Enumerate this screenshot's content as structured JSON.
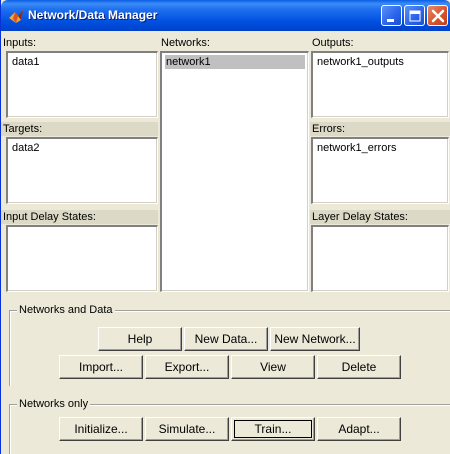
{
  "window": {
    "title": "Network/Data Manager",
    "app_icon": "matlab-logo-icon",
    "controls": [
      "minimize-icon",
      "maximize-icon",
      "close-icon"
    ]
  },
  "panels": {
    "inputs": {
      "label": "Inputs:",
      "items": [
        "data1"
      ]
    },
    "networks": {
      "label": "Networks:",
      "items": [
        "network1"
      ],
      "selected": "network1"
    },
    "outputs": {
      "label": "Outputs:",
      "items": [
        "network1_outputs"
      ]
    },
    "targets": {
      "label": "Targets:",
      "items": [
        "data2"
      ]
    },
    "errors": {
      "label": "Errors:",
      "items": [
        "network1_errors"
      ]
    },
    "input_delay_states": {
      "label": "Input Delay States:",
      "items": []
    },
    "layer_delay_states": {
      "label": "Layer Delay States:",
      "items": []
    }
  },
  "networks_and_data": {
    "title": "Networks and Data",
    "buttons": {
      "help": "Help",
      "new_data": "New Data...",
      "new_network": "New Network...",
      "import": "Import...",
      "export": "Export...",
      "view": "View",
      "delete": "Delete"
    }
  },
  "networks_only": {
    "title": "Networks only",
    "buttons": {
      "initialize": "Initialize...",
      "simulate": "Simulate...",
      "train": "Train...",
      "adapt": "Adapt..."
    }
  },
  "colors": {
    "title_bar": "#0050e0",
    "window_face": "#ece9d8",
    "selection": "#c0c0c0",
    "close_button": "#d8552c"
  }
}
